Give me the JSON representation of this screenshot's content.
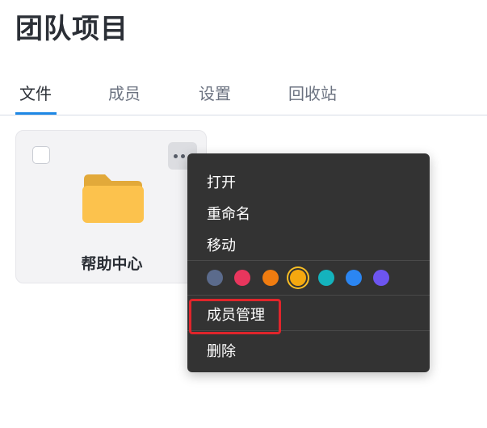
{
  "page": {
    "title": "团队项目"
  },
  "tabs": [
    {
      "label": "文件",
      "active": true
    },
    {
      "label": "成员",
      "active": false
    },
    {
      "label": "设置",
      "active": false
    },
    {
      "label": "回收站",
      "active": false
    }
  ],
  "folder": {
    "name": "帮助中心",
    "icon": "folder-icon",
    "color": "#fcc24d"
  },
  "context_menu": {
    "items": {
      "open": "打开",
      "rename": "重命名",
      "move": "移动",
      "members": "成员管理",
      "delete": "删除"
    },
    "colors": [
      {
        "name": "slate",
        "hex": "#5b6b8c",
        "selected": false
      },
      {
        "name": "rose",
        "hex": "#e8365d",
        "selected": false
      },
      {
        "name": "orange",
        "hex": "#f07c10",
        "selected": false
      },
      {
        "name": "amber",
        "hex": "#f5a80f",
        "selected": true
      },
      {
        "name": "teal",
        "hex": "#14b3bd",
        "selected": false
      },
      {
        "name": "blue",
        "hex": "#2b86f2",
        "selected": false
      },
      {
        "name": "violet",
        "hex": "#6d55f0",
        "selected": false
      }
    ]
  },
  "highlight": {
    "target": "members",
    "color": "#e0252b"
  }
}
